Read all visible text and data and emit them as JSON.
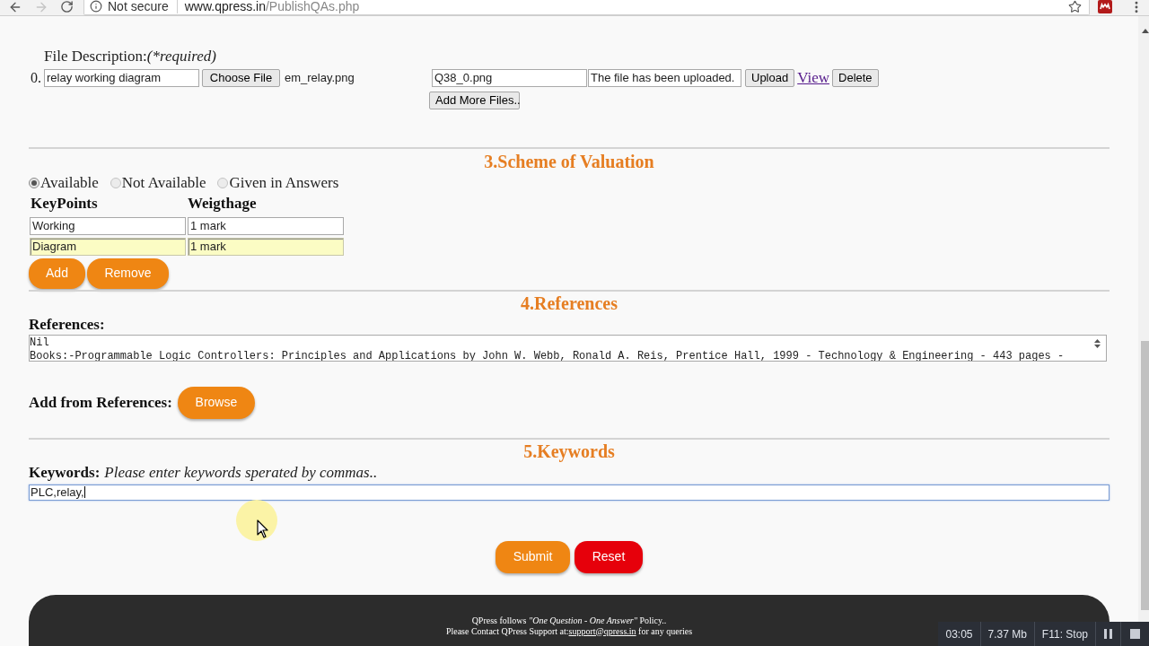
{
  "browser": {
    "security": "Not secure",
    "url_domain": "www.qpress.in",
    "url_path": "/PublishQAs.php"
  },
  "upload": {
    "description_label": "File Description:",
    "required_note": "(*required)",
    "files": [
      {
        "index": "0.",
        "description": "relay working diagram",
        "choose_button": "Choose File",
        "chosen_file": "em_relay.png",
        "stored_name": "Q38_0.png",
        "status": "The file has been uploaded.",
        "upload_button": "Upload",
        "view_link": "View",
        "delete_button": "Delete"
      }
    ],
    "add_more_button": "Add More Files.."
  },
  "valuation": {
    "heading": "3.Scheme of Valuation",
    "options": [
      {
        "label": "Available",
        "selected": true
      },
      {
        "label": "Not Available",
        "selected": false
      },
      {
        "label": "Given in Answers",
        "selected": false
      }
    ],
    "columns": [
      "KeyPoints",
      "Weigthage"
    ],
    "rows": [
      {
        "keypoint": "Working",
        "weightage": "1 mark",
        "autofilled": false
      },
      {
        "keypoint": "Diagram",
        "weightage": "1 mark",
        "autofilled": true
      }
    ],
    "buttons": [
      "Add",
      "Remove"
    ]
  },
  "references": {
    "heading": "4.References",
    "label": "References:",
    "value": "Nil\nBooks:-Programmable Logic Controllers: Principles and Applications by John W. Webb, Ronald A. Reis, Prentice Hall, 1999 - Technology & Engineering - 443 pages -",
    "add_label": "Add from References:",
    "browse_button": "Browse"
  },
  "keywords": {
    "heading": "5.Keywords",
    "label": "Keywords:",
    "hint": "Please enter keywords sperated by commas..",
    "value": "PLC,relay,",
    "focused": true
  },
  "actions": [
    {
      "label": "Submit",
      "kind": "primary"
    },
    {
      "label": "Reset",
      "kind": "danger"
    }
  ],
  "footer": {
    "policy": "QPress follows *\"One Question - One Answer\"* Policy..",
    "contact_prefix": "Please Contact QPress Support at:",
    "email": "support@qpress.in",
    "contact_suffix": " for any queries"
  },
  "recorder": {
    "time": "03:05",
    "size": "7.37 Mb",
    "hotkey": "F11: Stop"
  }
}
